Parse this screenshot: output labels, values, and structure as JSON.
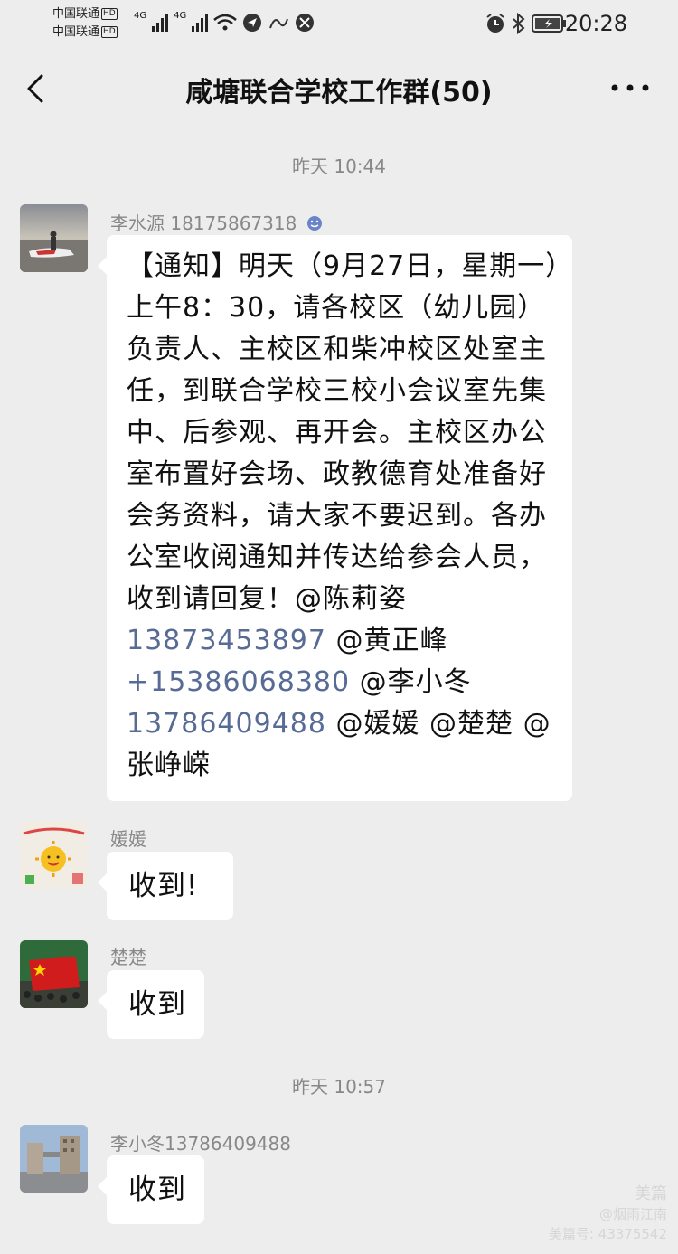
{
  "status_bar": {
    "carrier_1": "中国联通",
    "carrier_2": "中国联通",
    "hd": "HD",
    "net_1": "4G",
    "net_2": "4G",
    "time": "20:28"
  },
  "nav": {
    "title": "咸塘联合学校工作群(50)"
  },
  "timestamps": [
    "昨天 10:44",
    "昨天 10:57"
  ],
  "messages": [
    {
      "sender": "李水源 18175867318",
      "lines": [
        "【通知】明天（9月27日，星期一）",
        "上午8：30，请各校区（幼儿园）",
        "负责人、主校区和柴冲校区处室主",
        "任，到联合学校三校小会议室先集",
        "中、后参观、再开会。主校区办公",
        "室布置好会场、政教德育处准备好",
        "会务资料，请大家不要迟到。各办",
        "公室收阅通知并传达给参会人员，",
        "收到请回复！@陈莉姿"
      ],
      "phone_1": "13873453897",
      "mention_1": " @黄正峰",
      "phone_2": "+15386068380",
      "mention_2": " @李小冬",
      "phone_3": "13786409488",
      "mention_3": " @媛媛  @楚楚  @",
      "last_line": "张峥嵘"
    },
    {
      "sender": "媛媛",
      "text": "收到!"
    },
    {
      "sender": "楚楚",
      "text": "收到"
    },
    {
      "sender": "李小冬13786409488",
      "text": "收到"
    }
  ],
  "watermark": {
    "brand": "美篇",
    "author": "@烟雨江南",
    "id": "美篇号: 43375542"
  }
}
